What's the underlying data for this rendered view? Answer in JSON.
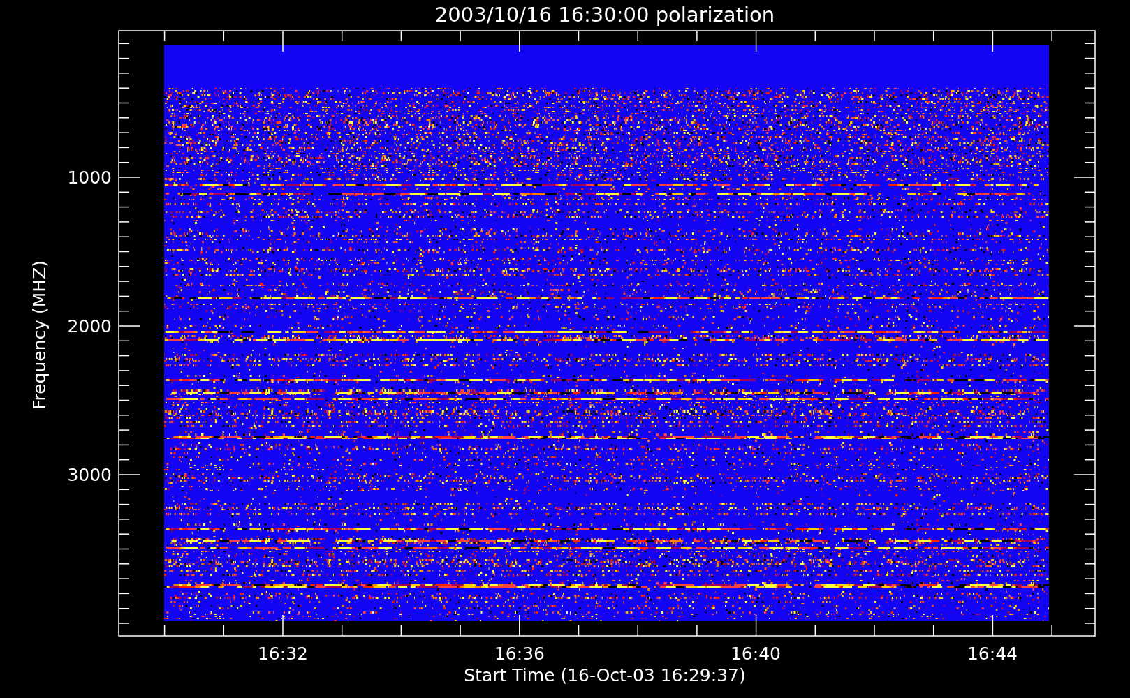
{
  "plot": {
    "title": "2003/10/16 16:30:00 polarization",
    "y_axis": {
      "label": "Frequency (MHZ)",
      "ticks": [
        "1000",
        "2000",
        "3000"
      ]
    },
    "x_axis": {
      "label": "Start Time (16-Oct-03 16:29:37)",
      "ticks": [
        "16:32",
        "16:36",
        "16:40",
        "16:44"
      ]
    }
  }
}
